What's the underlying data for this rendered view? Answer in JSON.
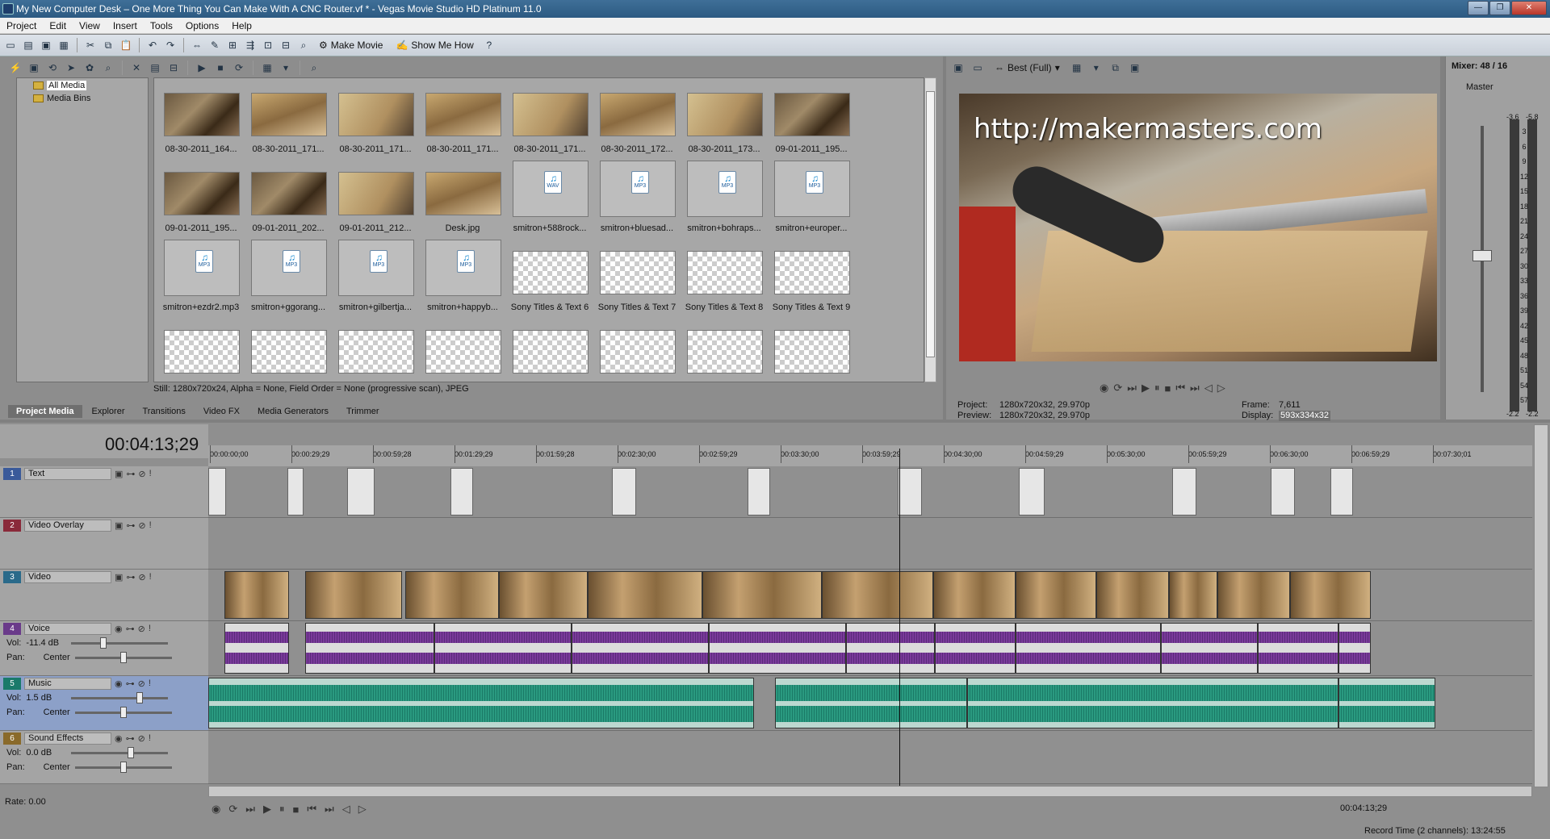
{
  "window": {
    "title": "My New Computer Desk – One More Thing You Can Make With A CNC Router.vf * - Vegas Movie Studio HD Platinum 11.0"
  },
  "menu": [
    "Project",
    "Edit",
    "View",
    "Insert",
    "Tools",
    "Options",
    "Help"
  ],
  "toolbar": {
    "make_movie": "Make Movie",
    "show_me_how": "Show Me How"
  },
  "tree": {
    "items": [
      {
        "label": "All Media",
        "selected": true
      },
      {
        "label": "Media Bins",
        "selected": false
      }
    ]
  },
  "media": [
    {
      "label": "08-30-2011_164...",
      "kind": "video1"
    },
    {
      "label": "08-30-2011_171...",
      "kind": "video2"
    },
    {
      "label": "08-30-2011_171...",
      "kind": "video3"
    },
    {
      "label": "08-30-2011_171...",
      "kind": "video2"
    },
    {
      "label": "08-30-2011_171...",
      "kind": "video3"
    },
    {
      "label": "08-30-2011_172...",
      "kind": "video2"
    },
    {
      "label": "08-30-2011_173...",
      "kind": "video3"
    },
    {
      "label": "09-01-2011_195...",
      "kind": "video1"
    },
    {
      "label": "09-01-2011_195...",
      "kind": "video1"
    },
    {
      "label": "09-01-2011_202...",
      "kind": "video1"
    },
    {
      "label": "09-01-2011_212...",
      "kind": "video3"
    },
    {
      "label": "Desk.jpg",
      "kind": "video2"
    },
    {
      "label": "smitron+588rock...",
      "kind": "wav"
    },
    {
      "label": "smitron+bluesad...",
      "kind": "mp3"
    },
    {
      "label": "smitron+bohraps...",
      "kind": "mp3"
    },
    {
      "label": "smitron+europer...",
      "kind": "mp3"
    },
    {
      "label": "smitron+ezdr2.mp3",
      "kind": "mp3"
    },
    {
      "label": "smitron+ggorang...",
      "kind": "mp3"
    },
    {
      "label": "smitron+gilbertja...",
      "kind": "mp3"
    },
    {
      "label": "smitron+happyb...",
      "kind": "mp3"
    },
    {
      "label": "Sony Titles & Text 6",
      "kind": "title"
    },
    {
      "label": "Sony Titles & Text 7",
      "kind": "title"
    },
    {
      "label": "Sony Titles & Text 8",
      "kind": "title"
    },
    {
      "label": "Sony Titles & Text 9",
      "kind": "title"
    },
    {
      "label": "",
      "kind": "title"
    },
    {
      "label": "",
      "kind": "title"
    },
    {
      "label": "",
      "kind": "title"
    },
    {
      "label": "",
      "kind": "title"
    },
    {
      "label": "",
      "kind": "title"
    },
    {
      "label": "",
      "kind": "title"
    },
    {
      "label": "",
      "kind": "title"
    },
    {
      "label": "",
      "kind": "title"
    }
  ],
  "file_badges": {
    "wav": "WAV",
    "mp3": "MP3"
  },
  "status_line": "Still: 1280x720x24, Alpha = None, Field Order = None (progressive scan), JPEG",
  "tabs": [
    {
      "label": "Project Media",
      "active": true
    },
    {
      "label": "Explorer",
      "active": false
    },
    {
      "label": "Transitions",
      "active": false
    },
    {
      "label": "Video FX",
      "active": false
    },
    {
      "label": "Media Generators",
      "active": false
    },
    {
      "label": "Trimmer",
      "active": false
    }
  ],
  "preview": {
    "quality": "Best (Full)",
    "overlay_text": "http://makermasters.com",
    "project_label": "Project:",
    "project_value": "1280x720x32, 29.970p",
    "preview_label": "Preview:",
    "preview_value": "1280x720x32, 29.970p",
    "frame_label": "Frame:",
    "frame_value": "7,611",
    "display_label": "Display:",
    "display_value": "593x334x32"
  },
  "mixer": {
    "title": "Mixer: 48 / 16",
    "master_label": "Master",
    "peak_left": "-3.6",
    "peak_right": "-5.8",
    "bottom_left": "-2.2",
    "bottom_right": "-2.2",
    "db_scale": [
      "3",
      "6",
      "9",
      "12",
      "15",
      "18",
      "21",
      "24",
      "27",
      "30",
      "33",
      "36",
      "39",
      "42",
      "45",
      "48",
      "51",
      "54",
      "57"
    ]
  },
  "timeline": {
    "timecode": "00:04:13;29",
    "ruler": [
      "00:00:00;00",
      "00:00:29;29",
      "00:00:59;28",
      "00:01:29;29",
      "00:01:59;28",
      "00:02:30;00",
      "00:02:59;29",
      "00:03:30;00",
      "00:03:59;29",
      "00:04:30;00",
      "00:04:59;29",
      "00:05:30;00",
      "00:05:59;29",
      "00:06:30;00",
      "00:06:59;29",
      "00:07:30;01"
    ],
    "rate": "Rate: 0.00",
    "end_timecode": "00:04:13;29",
    "record_time": "Record Time (2 channels): 13:24:55"
  },
  "tracks": [
    {
      "num": "1",
      "name": "Text",
      "color": "#3a5a9a",
      "type": "text"
    },
    {
      "num": "2",
      "name": "Video Overlay",
      "color": "#8a2a3a",
      "type": "video"
    },
    {
      "num": "3",
      "name": "Video",
      "color": "#2a6a8a",
      "type": "video"
    },
    {
      "num": "4",
      "name": "Voice",
      "color": "#6a3a8a",
      "type": "audio",
      "vol_label": "Vol:",
      "vol": "-11.4 dB",
      "vol_level": 0.32,
      "pan_label": "Pan:",
      "pan": "Center",
      "pan_level": 0.5
    },
    {
      "num": "5",
      "name": "Music",
      "color": "#1a7a6a",
      "type": "audio",
      "vol_label": "Vol:",
      "vol": "1.5 dB",
      "vol_level": 0.72,
      "pan_label": "Pan:",
      "pan": "Center",
      "pan_level": 0.5
    },
    {
      "num": "6",
      "name": "Sound Effects",
      "color": "#8a6a2a",
      "type": "audio",
      "vol_label": "Vol:",
      "vol": "0.0 dB",
      "vol_level": 0.62,
      "pan_label": "Pan:",
      "pan": "Center",
      "pan_level": 0.5
    }
  ],
  "icons": {
    "new": "new-file-icon",
    "open": "open-folder-icon",
    "save": "save-icon",
    "cut": "cut-icon",
    "copy": "copy-icon",
    "paste": "paste-icon",
    "undo": "undo-icon",
    "redo": "redo-icon",
    "help": "help-icon"
  }
}
